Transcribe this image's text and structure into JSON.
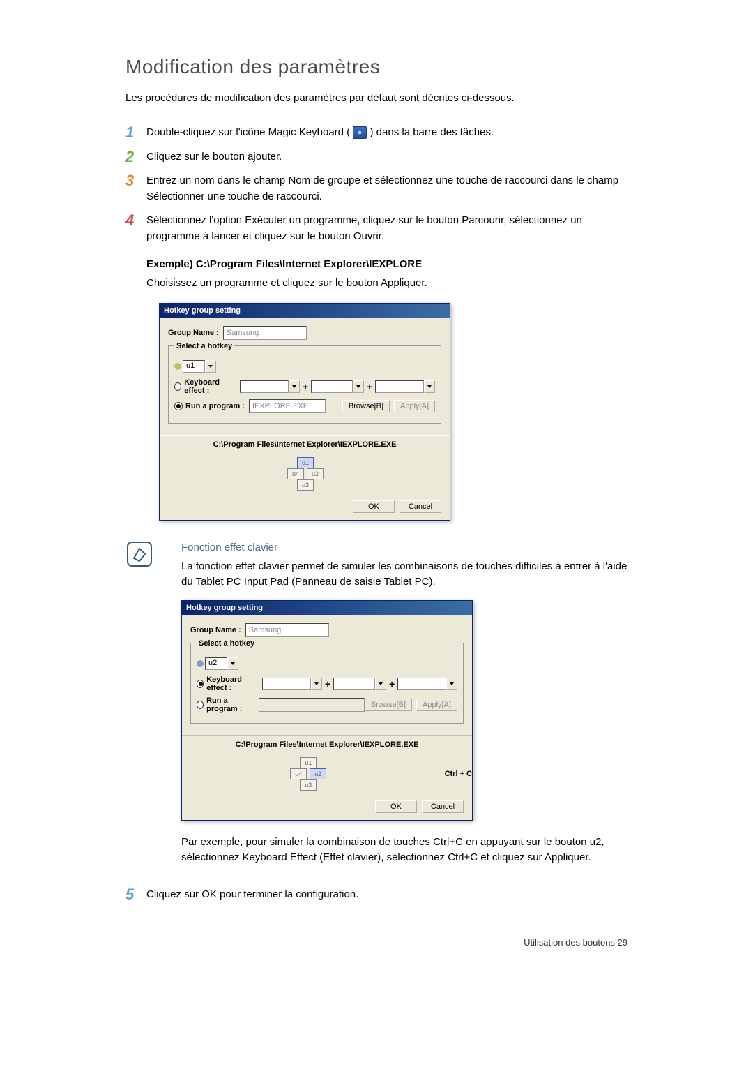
{
  "title": "Modification des paramètres",
  "intro": "Les procédures de modification des paramètres par défaut sont décrites ci-dessous.",
  "steps": {
    "s1a": "Double-cliquez sur l'icône Magic Keyboard (",
    "s1b": ") dans la barre des tâches.",
    "s2": "Cliquez sur le bouton ajouter.",
    "s3": "Entrez un nom dans le champ Nom de groupe et sélectionnez une touche de raccourci dans le champ Sélectionner une touche de raccourci.",
    "s4": "Sélectionnez l'option Exécuter un programme, cliquez sur le bouton Parcourir, sélectionnez un programme à lancer et cliquez sur le bouton Ouvrir.",
    "s5": "Cliquez sur  OK pour terminer la configuration."
  },
  "step_labels": {
    "n1": "1",
    "n2": "2",
    "n3": "3",
    "n4": "4",
    "n5": "5"
  },
  "example_label": "Exemple) C:\\Program Files\\Internet Explorer\\IEXPLORE",
  "example_sub": "Choisissez un programme et cliquez sur le bouton Appliquer.",
  "dialog": {
    "title": "Hotkey group setting",
    "group_name_label": "Group Name :",
    "group_name_value": "Samsung",
    "select_hotkey_label": "Select a hotkey",
    "hotkey1": "u1",
    "hotkey2": "u2",
    "keyboard_effect_label": "Keyboard effect :",
    "run_label": "Run a program :",
    "run_value": "IEXPLORE.EXE",
    "browse": "Browse[B]",
    "apply": "Apply[A]",
    "path": "C:\\Program Files\\Internet Explorer\\IEXPLORE.EXE",
    "ok": "OK",
    "cancel": "Cancel",
    "u1": "u1",
    "u2": "u2",
    "u3": "u3",
    "u4": "u4",
    "ctrl_c": "Ctrl + C",
    "plus": "+"
  },
  "note": {
    "title": "Fonction effet clavier",
    "body": "La fonction effet clavier permet de simuler les combinaisons de touches difficiles à entrer à l'aide du Tablet PC Input Pad (Panneau de saisie Tablet PC).",
    "after": "Par exemple, pour simuler la combinaison de touches Ctrl+C en appuyant sur le bouton u2, sélectionnez Keyboard Effect (Effet clavier), sélectionnez Ctrl+C et cliquez sur Appliquer."
  },
  "footer": "Utilisation des boutons   29"
}
